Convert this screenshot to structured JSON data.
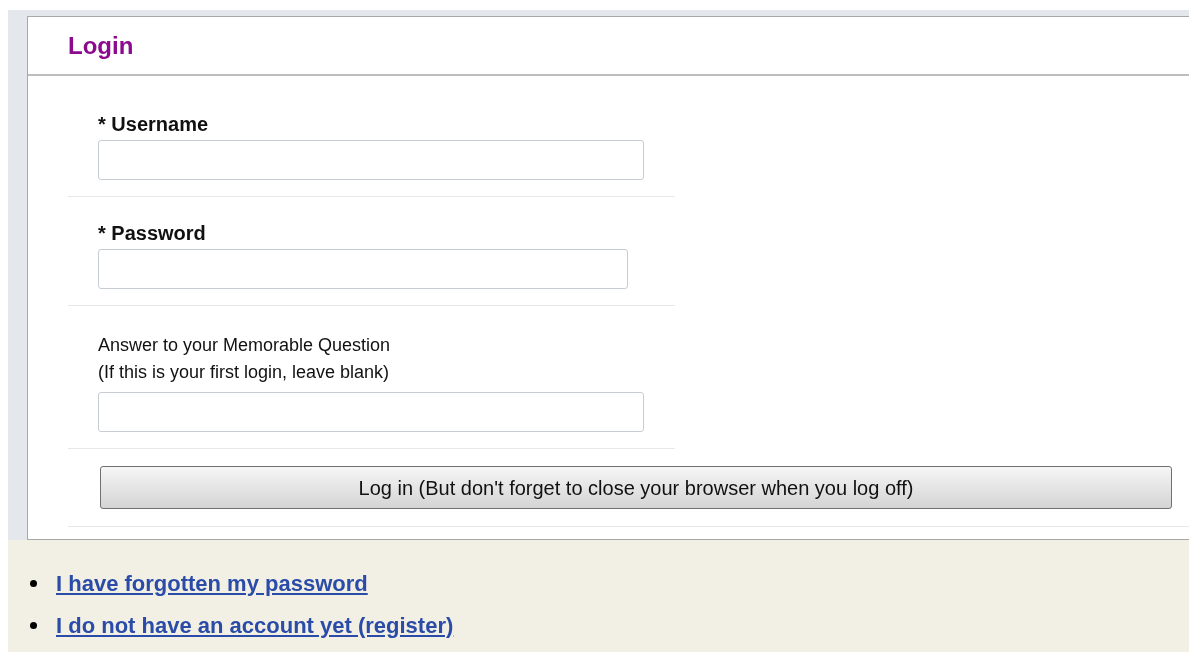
{
  "panel": {
    "title": "Login"
  },
  "fields": [
    {
      "kind": "required",
      "label": "* Username"
    },
    {
      "kind": "required",
      "label": "* Password"
    },
    {
      "kind": "optional",
      "label": "Answer to your Memorable Question",
      "hint": "(If this is your first login, leave blank)"
    }
  ],
  "submit_button": "Log in (But don't forget to close your browser when you log off)",
  "links": [
    "I have forgotten my password",
    "I do not have an account yet (register)"
  ]
}
